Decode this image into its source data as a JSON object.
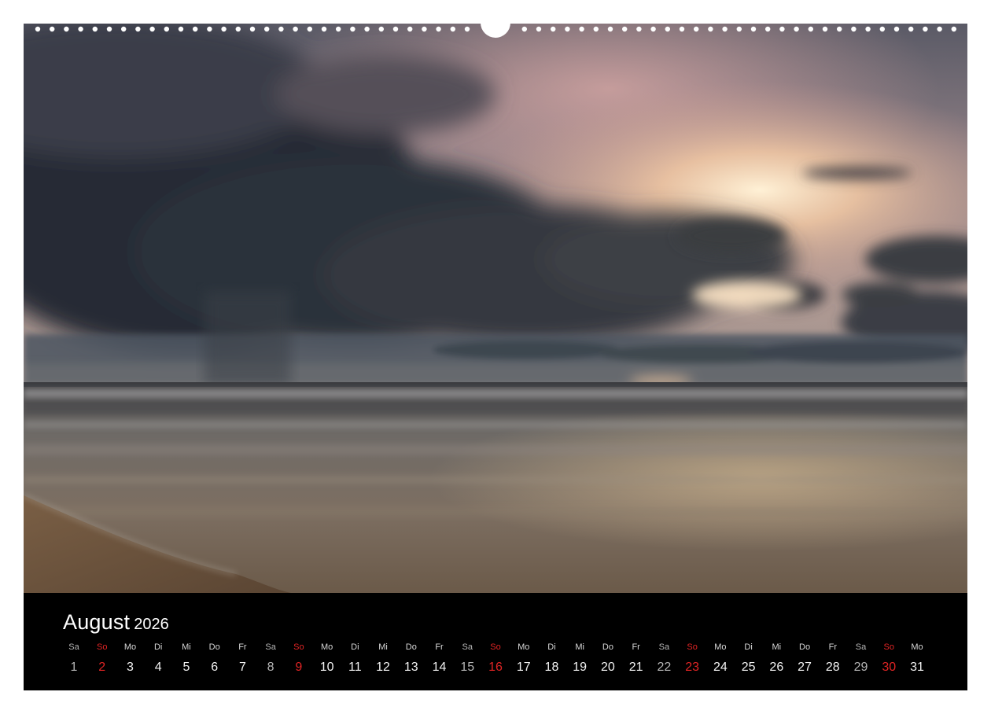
{
  "calendar": {
    "month": "August",
    "year": "2026",
    "days": [
      {
        "wd": "Sa",
        "dn": "1",
        "type": "sat"
      },
      {
        "wd": "So",
        "dn": "2",
        "type": "sun"
      },
      {
        "wd": "Mo",
        "dn": "3",
        "type": "wk"
      },
      {
        "wd": "Di",
        "dn": "4",
        "type": "wk"
      },
      {
        "wd": "Mi",
        "dn": "5",
        "type": "wk"
      },
      {
        "wd": "Do",
        "dn": "6",
        "type": "wk"
      },
      {
        "wd": "Fr",
        "dn": "7",
        "type": "wk"
      },
      {
        "wd": "Sa",
        "dn": "8",
        "type": "sat"
      },
      {
        "wd": "So",
        "dn": "9",
        "type": "sun"
      },
      {
        "wd": "Mo",
        "dn": "10",
        "type": "wk"
      },
      {
        "wd": "Di",
        "dn": "11",
        "type": "wk"
      },
      {
        "wd": "Mi",
        "dn": "12",
        "type": "wk"
      },
      {
        "wd": "Do",
        "dn": "13",
        "type": "wk"
      },
      {
        "wd": "Fr",
        "dn": "14",
        "type": "wk"
      },
      {
        "wd": "Sa",
        "dn": "15",
        "type": "sat"
      },
      {
        "wd": "So",
        "dn": "16",
        "type": "sun"
      },
      {
        "wd": "Mo",
        "dn": "17",
        "type": "wk"
      },
      {
        "wd": "Di",
        "dn": "18",
        "type": "wk"
      },
      {
        "wd": "Mi",
        "dn": "19",
        "type": "wk"
      },
      {
        "wd": "Do",
        "dn": "20",
        "type": "wk"
      },
      {
        "wd": "Fr",
        "dn": "21",
        "type": "wk"
      },
      {
        "wd": "Sa",
        "dn": "22",
        "type": "sat"
      },
      {
        "wd": "So",
        "dn": "23",
        "type": "sun"
      },
      {
        "wd": "Mo",
        "dn": "24",
        "type": "wk"
      },
      {
        "wd": "Di",
        "dn": "25",
        "type": "wk"
      },
      {
        "wd": "Mi",
        "dn": "26",
        "type": "wk"
      },
      {
        "wd": "Do",
        "dn": "27",
        "type": "wk"
      },
      {
        "wd": "Fr",
        "dn": "28",
        "type": "wk"
      },
      {
        "wd": "Sa",
        "dn": "29",
        "type": "sat"
      },
      {
        "wd": "So",
        "dn": "30",
        "type": "sun"
      },
      {
        "wd": "Mo",
        "dn": "31",
        "type": "wk"
      }
    ]
  },
  "colors": {
    "sunday": "#e02424",
    "saturday": "#b5b5b5",
    "strip_background": "#000000"
  },
  "photo": {
    "subject": "stormy-sea-sunset-beach"
  }
}
